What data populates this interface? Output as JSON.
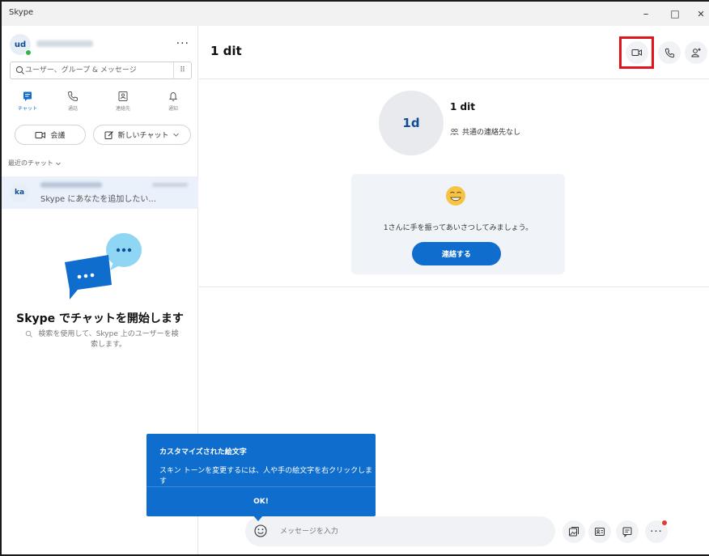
{
  "window": {
    "title": "Skype"
  },
  "window_controls": {
    "minimize": "–",
    "maximize": "□",
    "close": "✕"
  },
  "profile": {
    "initials": "ud",
    "more": "···"
  },
  "search": {
    "placeholder": "ユーザー、グループ & メッセージ",
    "dialpad": "⠿"
  },
  "nav": {
    "chats": "チャット",
    "calls": "通話",
    "contacts": "連絡先",
    "notifications": "通知"
  },
  "actions": {
    "meeting": "会議",
    "new_chat": "新しいチャット"
  },
  "recent": {
    "header": "最近のチャット"
  },
  "chat_item": {
    "initials": "ka",
    "preview": "Skype にあなたを追加したい..."
  },
  "empty_state": {
    "title": "Skype でチャットを開始します",
    "subtitle": "検索を使用して、Skype 上のユーザーを検索します。"
  },
  "conversation": {
    "name": "1 dit",
    "avatar_initials": "1d",
    "mutual_contacts": "共通の連絡先なし",
    "wave_prompt": "1さんに手を振ってあいさつしてみましょう。",
    "contact_button": "連絡する"
  },
  "composer": {
    "placeholder": "メッセージを入力",
    "more": "···"
  },
  "tooltip": {
    "title": "カスタマイズされた絵文字",
    "body": "スキン トーンを変更するには、人や手の絵文字を右クリックします",
    "ok": "OK!"
  },
  "colors": {
    "accent": "#0f6ecd",
    "highlight": "#e0141b",
    "presence": "#36b24a",
    "notification": "#e53935"
  },
  "icons": {
    "search": "search-icon",
    "dialpad": "dialpad-icon",
    "video": "video-call-icon",
    "call": "phone-icon",
    "add_person": "add-person-icon",
    "emoji": "emoji-icon",
    "gallery": "image-gallery-icon",
    "contact_card": "contact-card-icon",
    "chat": "chat-icon"
  }
}
